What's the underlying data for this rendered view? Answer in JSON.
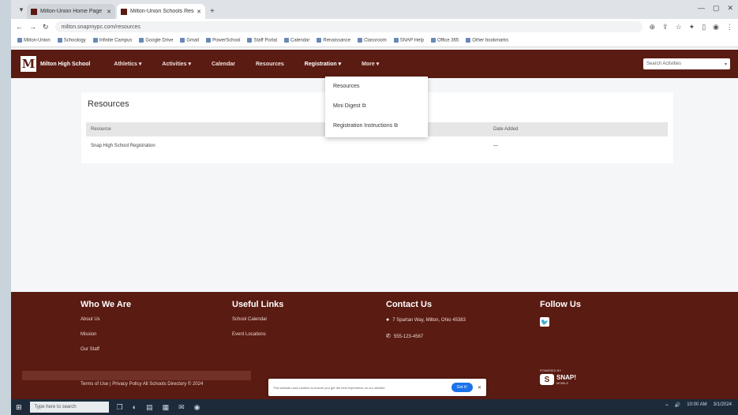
{
  "browser": {
    "tabs": [
      {
        "title": "Milton-Union Home Page",
        "active": false
      },
      {
        "title": "Milton-Union Schools Resources",
        "active": true
      }
    ],
    "new_tab": "+",
    "url": "milton.snapmypc.com/resources",
    "bookmarks": [
      "Milton-Union",
      "Schoology",
      "Infinite Campus",
      "Google Drive",
      "Gmail",
      "PowerSchool",
      "Staff Portal",
      "Calendar",
      "Renaissance",
      "Classroom",
      "SNAP Help",
      "Office 365",
      "Other bookmarks"
    ]
  },
  "site": {
    "logo_letter": "M",
    "school_name": "Milton High School",
    "nav": [
      "Athletics ▾",
      "Activities ▾",
      "Calendar",
      "Resources",
      "Registration ▾",
      "More ▾"
    ],
    "search_placeholder": "Search Activities"
  },
  "dropdown": {
    "items": [
      "Resources",
      "Mini Digest",
      "Registration Instructions"
    ]
  },
  "content": {
    "title": "Resources",
    "columns": [
      "Resource",
      "Date Added"
    ],
    "rows": [
      [
        "Snap High School Registration",
        "—"
      ]
    ]
  },
  "footer": {
    "who_we_are": {
      "title": "Who We Are",
      "links": [
        "About Us",
        "Mission",
        "Our Staff"
      ]
    },
    "useful_links": {
      "title": "Useful Links",
      "links": [
        "School Calendar",
        "Event Locations"
      ]
    },
    "contact": {
      "title": "Contact Us",
      "address": "7 Spartan Way, Milton, Ohio 45383",
      "phone": "555-123-4567"
    },
    "follow": {
      "title": "Follow Us"
    },
    "powered_by": "POWERED BY",
    "snap_name": "SNAP!",
    "snap_sub": "MOBILE",
    "legal": "Terms of Use | Privacy Policy   All Schools Directory   © 2024"
  },
  "cookie": {
    "text": "This website uses cookies to ensure you get the best experience on our website.",
    "button": "Got it!",
    "close": "✕"
  },
  "taskbar": {
    "search_placeholder": "Type here to search",
    "clock": "10:00 AM",
    "date": "3/1/2024"
  }
}
